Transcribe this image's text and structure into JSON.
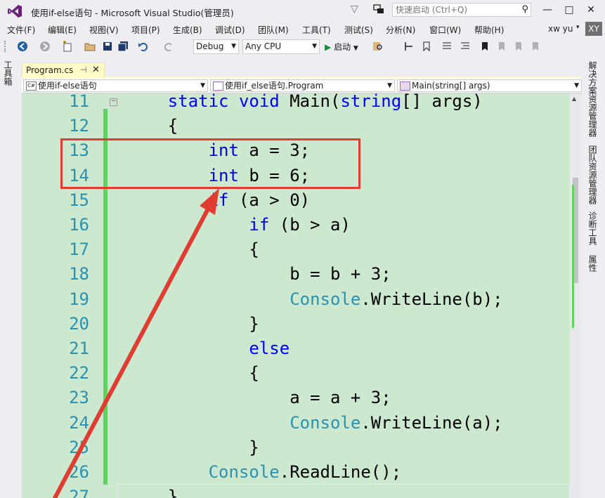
{
  "window": {
    "title": "使用if-else语句 - Microsoft Visual Studio(管理员)",
    "quick_launch_placeholder": "快速启动 (Ctrl+Q)",
    "minimize": "—",
    "maximize": "□",
    "close": "✕"
  },
  "menu": {
    "items": [
      "文件(F)",
      "编辑(E)",
      "视图(V)",
      "项目(P)",
      "生成(B)",
      "调试(D)",
      "团队(M)",
      "工具(T)",
      "测试(S)",
      "分析(N)",
      "窗口(W)",
      "帮助(H)"
    ],
    "user_name": "xw yu",
    "user_initials": "XY"
  },
  "toolbar": {
    "configuration": "Debug",
    "platform": "Any CPU",
    "start_label": "启动"
  },
  "side_tabs": {
    "left": "工具箱",
    "right": [
      "解决方案资源管理器",
      "团队资源管理器",
      "诊断工具",
      "属性"
    ]
  },
  "document_tab": {
    "label": "Program.cs",
    "pin": "⊣",
    "close": "✕"
  },
  "navigation": {
    "project": "使用if-else语句",
    "type": "使用if_else语句.Program",
    "member": "Main(string[] args)"
  },
  "editor": {
    "line_numbers": [
      "11",
      "12",
      "13",
      "14",
      "15",
      "16",
      "17",
      "18",
      "19",
      "20",
      "21",
      "22",
      "23",
      "24",
      "25",
      "26",
      "27"
    ],
    "lines": [
      [
        {
          "t": "    "
        },
        {
          "t": "static",
          "c": "kw"
        },
        {
          "t": " "
        },
        {
          "t": "void",
          "c": "kw"
        },
        {
          "t": " Main("
        },
        {
          "t": "string",
          "c": "kw"
        },
        {
          "t": "[] args)"
        }
      ],
      [
        {
          "t": "    {"
        }
      ],
      [
        {
          "t": "        "
        },
        {
          "t": "int",
          "c": "kw"
        },
        {
          "t": " a = 3;"
        }
      ],
      [
        {
          "t": "        "
        },
        {
          "t": "int",
          "c": "kw"
        },
        {
          "t": " b = 6;"
        }
      ],
      [
        {
          "t": "        "
        },
        {
          "t": "if",
          "c": "kw"
        },
        {
          "t": " (a > 0)"
        }
      ],
      [
        {
          "t": "            "
        },
        {
          "t": "if",
          "c": "kw"
        },
        {
          "t": " (b > a)"
        }
      ],
      [
        {
          "t": "            {"
        }
      ],
      [
        {
          "t": "                b = b + 3;"
        }
      ],
      [
        {
          "t": "                "
        },
        {
          "t": "Console",
          "c": "ty"
        },
        {
          "t": ".WriteLine(b);"
        }
      ],
      [
        {
          "t": "            }"
        }
      ],
      [
        {
          "t": "            "
        },
        {
          "t": "else",
          "c": "kw"
        }
      ],
      [
        {
          "t": "            {"
        }
      ],
      [
        {
          "t": "                a = a + 3;"
        }
      ],
      [
        {
          "t": "                "
        },
        {
          "t": "Console",
          "c": "ty"
        },
        {
          "t": ".WriteLine(a);"
        }
      ],
      [
        {
          "t": "            }"
        }
      ],
      [
        {
          "t": "        "
        },
        {
          "t": "Console",
          "c": "ty"
        },
        {
          "t": ".ReadLine();"
        }
      ],
      [
        {
          "t": "    }"
        }
      ]
    ]
  },
  "colors": {
    "editor_background": "#cce8cf",
    "keyword": "#0000ff",
    "type": "#2b91af",
    "annotation": "#e03c31"
  }
}
